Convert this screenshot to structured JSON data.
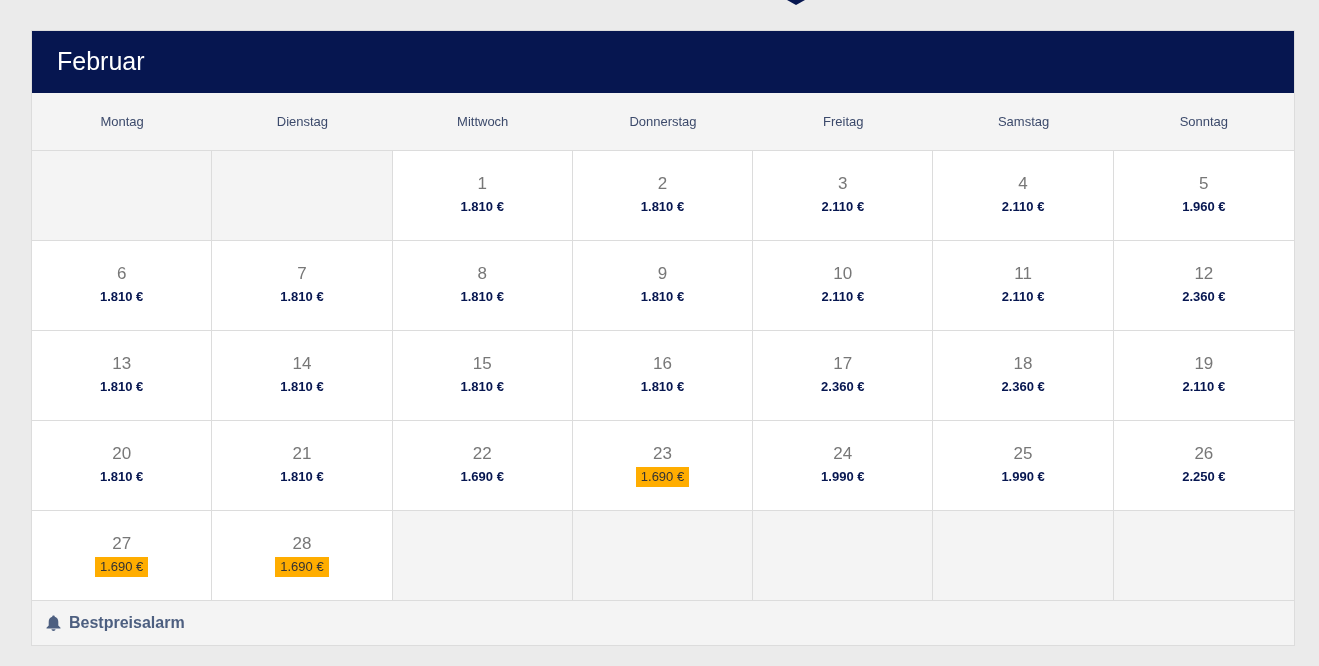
{
  "month": "Februar",
  "weekdays": [
    "Montag",
    "Dienstag",
    "Mittwoch",
    "Donnerstag",
    "Freitag",
    "Samstag",
    "Sonntag"
  ],
  "cells": [
    {
      "kind": "empty"
    },
    {
      "kind": "empty"
    },
    {
      "kind": "day",
      "day": "1",
      "price": "1.810 €",
      "best": false
    },
    {
      "kind": "day",
      "day": "2",
      "price": "1.810 €",
      "best": false
    },
    {
      "kind": "day",
      "day": "3",
      "price": "2.110 €",
      "best": false
    },
    {
      "kind": "day",
      "day": "4",
      "price": "2.110 €",
      "best": false
    },
    {
      "kind": "day",
      "day": "5",
      "price": "1.960 €",
      "best": false
    },
    {
      "kind": "day",
      "day": "6",
      "price": "1.810 €",
      "best": false
    },
    {
      "kind": "day",
      "day": "7",
      "price": "1.810 €",
      "best": false
    },
    {
      "kind": "day",
      "day": "8",
      "price": "1.810 €",
      "best": false
    },
    {
      "kind": "day",
      "day": "9",
      "price": "1.810 €",
      "best": false
    },
    {
      "kind": "day",
      "day": "10",
      "price": "2.110 €",
      "best": false
    },
    {
      "kind": "day",
      "day": "11",
      "price": "2.110 €",
      "best": false
    },
    {
      "kind": "day",
      "day": "12",
      "price": "2.360 €",
      "best": false
    },
    {
      "kind": "day",
      "day": "13",
      "price": "1.810 €",
      "best": false
    },
    {
      "kind": "day",
      "day": "14",
      "price": "1.810 €",
      "best": false
    },
    {
      "kind": "day",
      "day": "15",
      "price": "1.810 €",
      "best": false
    },
    {
      "kind": "day",
      "day": "16",
      "price": "1.810 €",
      "best": false
    },
    {
      "kind": "day",
      "day": "17",
      "price": "2.360 €",
      "best": false
    },
    {
      "kind": "day",
      "day": "18",
      "price": "2.360 €",
      "best": false
    },
    {
      "kind": "day",
      "day": "19",
      "price": "2.110 €",
      "best": false
    },
    {
      "kind": "day",
      "day": "20",
      "price": "1.810 €",
      "best": false
    },
    {
      "kind": "day",
      "day": "21",
      "price": "1.810 €",
      "best": false
    },
    {
      "kind": "day",
      "day": "22",
      "price": "1.690 €",
      "best": false
    },
    {
      "kind": "day",
      "day": "23",
      "price": "1.690 €",
      "best": true
    },
    {
      "kind": "day",
      "day": "24",
      "price": "1.990 €",
      "best": false
    },
    {
      "kind": "day",
      "day": "25",
      "price": "1.990 €",
      "best": false
    },
    {
      "kind": "day",
      "day": "26",
      "price": "2.250 €",
      "best": false
    },
    {
      "kind": "day",
      "day": "27",
      "price": "1.690 €",
      "best": true
    },
    {
      "kind": "day",
      "day": "28",
      "price": "1.690 €",
      "best": true
    },
    {
      "kind": "empty"
    },
    {
      "kind": "empty"
    },
    {
      "kind": "empty"
    },
    {
      "kind": "empty"
    },
    {
      "kind": "empty"
    }
  ],
  "footer": {
    "label": "Bestpreisalarm"
  }
}
